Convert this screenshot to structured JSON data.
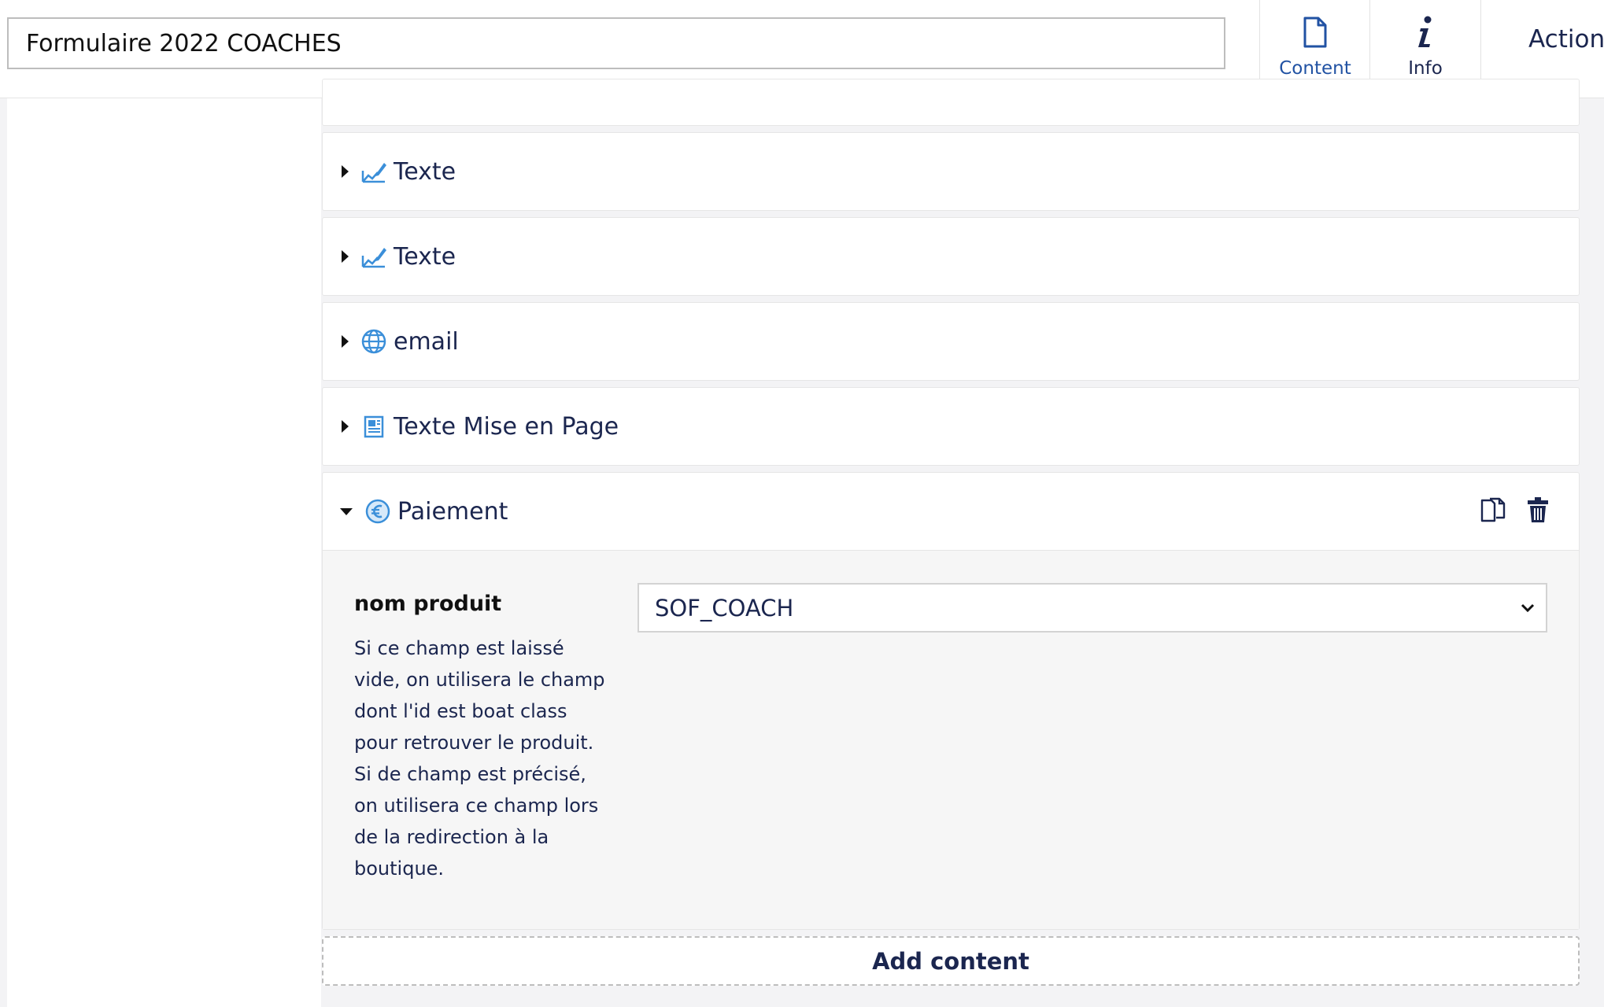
{
  "header": {
    "document_name": "Formulaire 2022 COACHES",
    "apps": [
      {
        "label": "Content",
        "icon": "document-icon",
        "active": true
      },
      {
        "label": "Info",
        "icon": "info-icon",
        "active": false
      }
    ],
    "actions_label": "Actions"
  },
  "blocks": [
    {
      "title": "Texte",
      "icon": "edit-icon",
      "expanded": false
    },
    {
      "title": "Texte",
      "icon": "edit-icon",
      "expanded": false
    },
    {
      "title": "email",
      "icon": "globe-icon",
      "expanded": false
    },
    {
      "title": "Texte Mise en Page",
      "icon": "layout-icon",
      "expanded": false
    },
    {
      "title": "Paiement",
      "icon": "euro-icon",
      "expanded": true
    }
  ],
  "payment": {
    "property_label": "nom produit",
    "property_description": "Si ce champ est laissé vide, on utilisera le champ dont l'id est boat class pour retrouver le produit. Si de champ est précisé, on utilisera ce champ lors de la redirection à la boutique.",
    "selected_value": "SOF_COACH"
  },
  "add_content_label": "Add content",
  "colors": {
    "accent": "#2152a3",
    "icon_blue": "#3b8fd9",
    "active_bar": "#f0bcae",
    "text": "#1b264f"
  }
}
